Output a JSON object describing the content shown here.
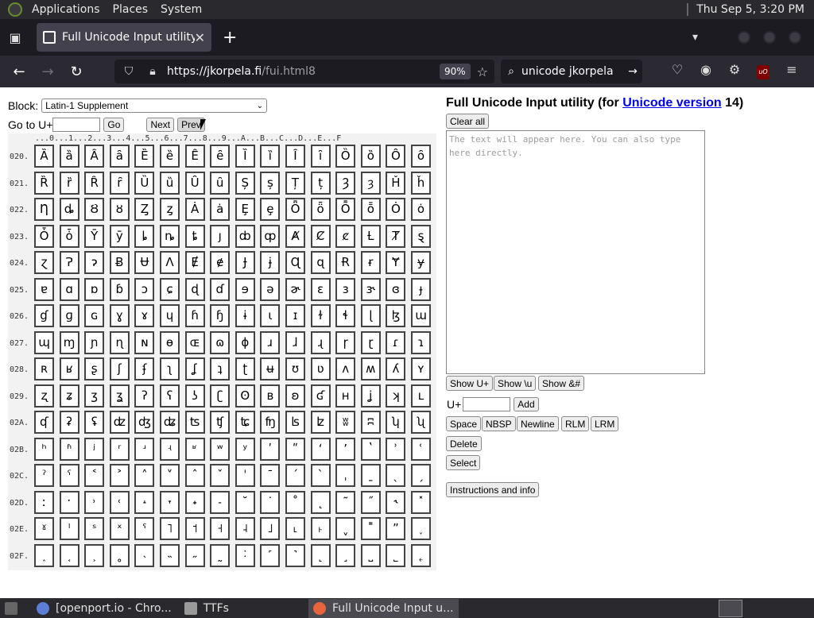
{
  "topbar": {
    "applications": "Applications",
    "places": "Places",
    "system": "System",
    "clock": "Thu Sep  5,  3:20 PM"
  },
  "browser": {
    "tab_title": "Full Unicode Input utility",
    "url_host": "https://jkorpela.fi",
    "url_path": "/fui.html8",
    "zoom": "90%",
    "search_text": "unicode jkorpela"
  },
  "form": {
    "block_label": "Block:",
    "block_value": "Latin-1 Supplement",
    "goto_label": "Go to U+",
    "go": "Go",
    "next": "Next",
    "prev": "Prev"
  },
  "grid": {
    "header": "...0...1...2...3...4...5...6...7...8...9...A...B...C...D...E...F",
    "rows": [
      {
        "label": "020.",
        "chars": [
          "Ȁ",
          "ȁ",
          "Ȃ",
          "ȃ",
          "Ȅ",
          "ȅ",
          "Ȇ",
          "ȇ",
          "Ȉ",
          "ȉ",
          "Ȋ",
          "ȋ",
          "Ȍ",
          "ȍ",
          "Ȏ",
          "ȏ"
        ]
      },
      {
        "label": "021.",
        "chars": [
          "Ȑ",
          "ȑ",
          "Ȓ",
          "ȓ",
          "Ȕ",
          "ȕ",
          "Ȗ",
          "ȗ",
          "Ș",
          "ș",
          "Ț",
          "ț",
          "Ȝ",
          "ȝ",
          "Ȟ",
          "ȟ"
        ]
      },
      {
        "label": "022.",
        "chars": [
          "Ƞ",
          "ȡ",
          "Ȣ",
          "ȣ",
          "Ȥ",
          "ȥ",
          "Ȧ",
          "ȧ",
          "Ȩ",
          "ȩ",
          "Ȫ",
          "ȫ",
          "Ȭ",
          "ȭ",
          "Ȯ",
          "ȯ"
        ]
      },
      {
        "label": "023.",
        "chars": [
          "Ȱ",
          "ȱ",
          "Ȳ",
          "ȳ",
          "ȴ",
          "ȵ",
          "ȶ",
          "ȷ",
          "ȸ",
          "ȹ",
          "Ⱥ",
          "Ȼ",
          "ȼ",
          "Ƚ",
          "Ⱦ",
          "ȿ"
        ]
      },
      {
        "label": "024.",
        "chars": [
          "ɀ",
          "Ɂ",
          "ɂ",
          "Ƀ",
          "Ʉ",
          "Ʌ",
          "Ɇ",
          "ɇ",
          "Ɉ",
          "ɉ",
          "Ɋ",
          "ɋ",
          "Ɍ",
          "ɍ",
          "Ɏ",
          "ɏ"
        ]
      },
      {
        "label": "025.",
        "chars": [
          "ɐ",
          "ɑ",
          "ɒ",
          "ɓ",
          "ɔ",
          "ɕ",
          "ɖ",
          "ɗ",
          "ɘ",
          "ə",
          "ɚ",
          "ɛ",
          "ɜ",
          "ɝ",
          "ɞ",
          "ɟ"
        ]
      },
      {
        "label": "026.",
        "chars": [
          "ɠ",
          "ɡ",
          "ɢ",
          "ɣ",
          "ɤ",
          "ɥ",
          "ɦ",
          "ɧ",
          "ɨ",
          "ɩ",
          "ɪ",
          "ɫ",
          "ɬ",
          "ɭ",
          "ɮ",
          "ɯ"
        ]
      },
      {
        "label": "027.",
        "chars": [
          "ɰ",
          "ɱ",
          "ɲ",
          "ɳ",
          "ɴ",
          "ɵ",
          "ɶ",
          "ɷ",
          "ɸ",
          "ɹ",
          "ɺ",
          "ɻ",
          "ɼ",
          "ɽ",
          "ɾ",
          "ɿ"
        ]
      },
      {
        "label": "028.",
        "chars": [
          "ʀ",
          "ʁ",
          "ʂ",
          "ʃ",
          "ʄ",
          "ʅ",
          "ʆ",
          "ʇ",
          "ʈ",
          "ʉ",
          "ʊ",
          "ʋ",
          "ʌ",
          "ʍ",
          "ʎ",
          "ʏ"
        ]
      },
      {
        "label": "029.",
        "chars": [
          "ʐ",
          "ʑ",
          "ʒ",
          "ʓ",
          "ʔ",
          "ʕ",
          "ʖ",
          "ʗ",
          "ʘ",
          "ʙ",
          "ʚ",
          "ʛ",
          "ʜ",
          "ʝ",
          "ʞ",
          "ʟ"
        ]
      },
      {
        "label": "02A.",
        "chars": [
          "ʠ",
          "ʡ",
          "ʢ",
          "ʣ",
          "ʤ",
          "ʥ",
          "ʦ",
          "ʧ",
          "ʨ",
          "ʩ",
          "ʪ",
          "ʫ",
          "ʬ",
          "ʭ",
          "ʮ",
          "ʯ"
        ]
      },
      {
        "label": "02B.",
        "chars": [
          "ʰ",
          "ʱ",
          "ʲ",
          "ʳ",
          "ʴ",
          "ʵ",
          "ʶ",
          "ʷ",
          "ʸ",
          "ʹ",
          "ʺ",
          "ʻ",
          "ʼ",
          "ʽ",
          "ʾ",
          "ʿ"
        ]
      },
      {
        "label": "02C.",
        "chars": [
          "ˀ",
          "ˁ",
          "˂",
          "˃",
          "˄",
          "˅",
          "ˆ",
          "ˇ",
          "ˈ",
          "ˉ",
          "ˊ",
          "ˋ",
          "ˌ",
          "ˍ",
          "ˎ",
          "ˏ"
        ]
      },
      {
        "label": "02D.",
        "chars": [
          "ː",
          "ˑ",
          "˒",
          "˓",
          "˔",
          "˕",
          "˖",
          "˗",
          "˘",
          "˙",
          "˚",
          "˛",
          "˜",
          "˝",
          "˞",
          "˟"
        ]
      },
      {
        "label": "02E.",
        "chars": [
          "ˠ",
          "ˡ",
          "ˢ",
          "ˣ",
          "ˤ",
          "˥",
          "˦",
          "˧",
          "˨",
          "˩",
          "˪",
          "˫",
          "ˬ",
          "˭",
          "ˮ",
          "˯"
        ]
      },
      {
        "label": "02F.",
        "chars": [
          "˰",
          "˱",
          "˲",
          "˳",
          "˴",
          "˵",
          "˶",
          "˷",
          "˸",
          "˹",
          "˺",
          "˻",
          "˼",
          "˽",
          "˾",
          "˿"
        ]
      }
    ]
  },
  "right": {
    "title_prefix": "Full Unicode Input utility (for ",
    "title_link": "Unicode version",
    "title_suffix": " 14)",
    "clear_all": "Clear all",
    "textarea_placeholder": "The text will appear here. You can also type here directly.",
    "show_u": "Show U+",
    "show_backslash_u": "Show \\u",
    "show_entity": "Show &#",
    "uplus_label": "U+",
    "add": "Add",
    "space": "Space",
    "nbsp": "NBSP",
    "newline": "Newline",
    "rlm": "RLM",
    "lrm": "LRM",
    "delete": "Delete",
    "select": "Select",
    "instructions": "Instructions and info"
  },
  "taskbar": {
    "item1": "[openport.io - Chro...",
    "item2": "TTFs",
    "item3": "Full Unicode Input u..."
  }
}
